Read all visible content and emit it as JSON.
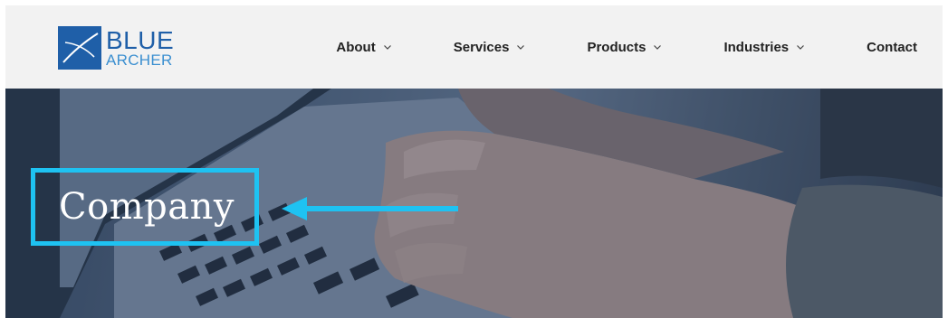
{
  "logo": {
    "line1": "BLUE",
    "line2": "ARCHER"
  },
  "nav": {
    "items": [
      {
        "label": "About",
        "has_dropdown": true
      },
      {
        "label": "Services",
        "has_dropdown": true
      },
      {
        "label": "Products",
        "has_dropdown": true
      },
      {
        "label": "Industries",
        "has_dropdown": true
      },
      {
        "label": "Contact",
        "has_dropdown": false
      }
    ]
  },
  "hero": {
    "title": "Company"
  },
  "colors": {
    "header_bg": "#f2f2f2",
    "brand_blue": "#1f5fa8",
    "brand_light_blue": "#3b8fd0",
    "highlight_cyan": "#1ec2f2",
    "nav_text": "#222222"
  }
}
